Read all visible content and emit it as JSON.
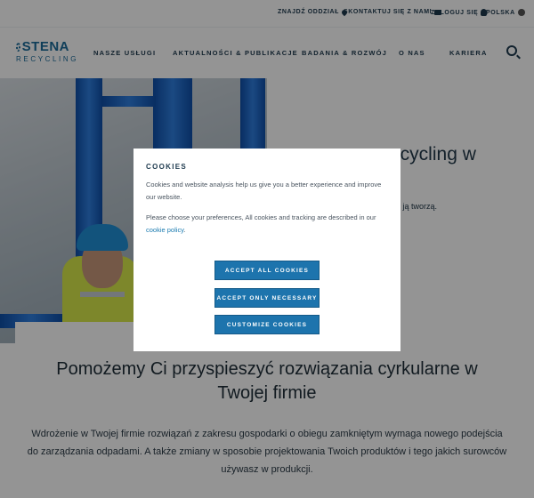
{
  "utility": {
    "find_office": "ZNAJDŹ ODDZIAŁ",
    "contact": "SKONTAKTUJ SIĘ Z NAMI",
    "login": "ZALOGUJ SIĘ",
    "language": "POLSKA"
  },
  "logo": {
    "name": "STENA",
    "sub": "RECYCLING"
  },
  "nav": {
    "items": [
      "NASZE USŁUGI",
      "AKTUALNOŚCI & PUBLIKACJE",
      "BADANIA & ROZWÓJ",
      "O NAS",
      "KARIERA"
    ]
  },
  "hero": {
    "title_fragment": "ecycling w",
    "text_fragment": "rzy ją tworzą."
  },
  "intro": {
    "heading": "Pomożemy Ci przyspieszyć rozwiązania cyrkularne w Twojej firmie",
    "body": "Wdrożenie w Twojej firmie rozwiązań z zakresu gospodarki o obiegu zamkniętym wymaga nowego podejścia do zarządzania odpadami. A także zmiany w sposobie projektowania Twoich produktów i tego jakich surowców używasz w produkcji."
  },
  "cookies": {
    "title": "COOKIES",
    "text1": "Cookies and website analysis help us give you a better experience and improve our website.",
    "text2_before": "Please choose your preferences, All cookies and tracking are described in our ",
    "text2_link": "cookie policy",
    "text2_after": ".",
    "accept_all": "ACCEPT ALL COOKIES",
    "accept_necessary": "ACCEPT ONLY NECESSARY",
    "customize": "CUSTOMIZE COOKIES"
  },
  "colors": {
    "brand_blue": "#1b6b9a",
    "button_blue": "#1d74ad",
    "nav_text": "#1e3a4e"
  }
}
